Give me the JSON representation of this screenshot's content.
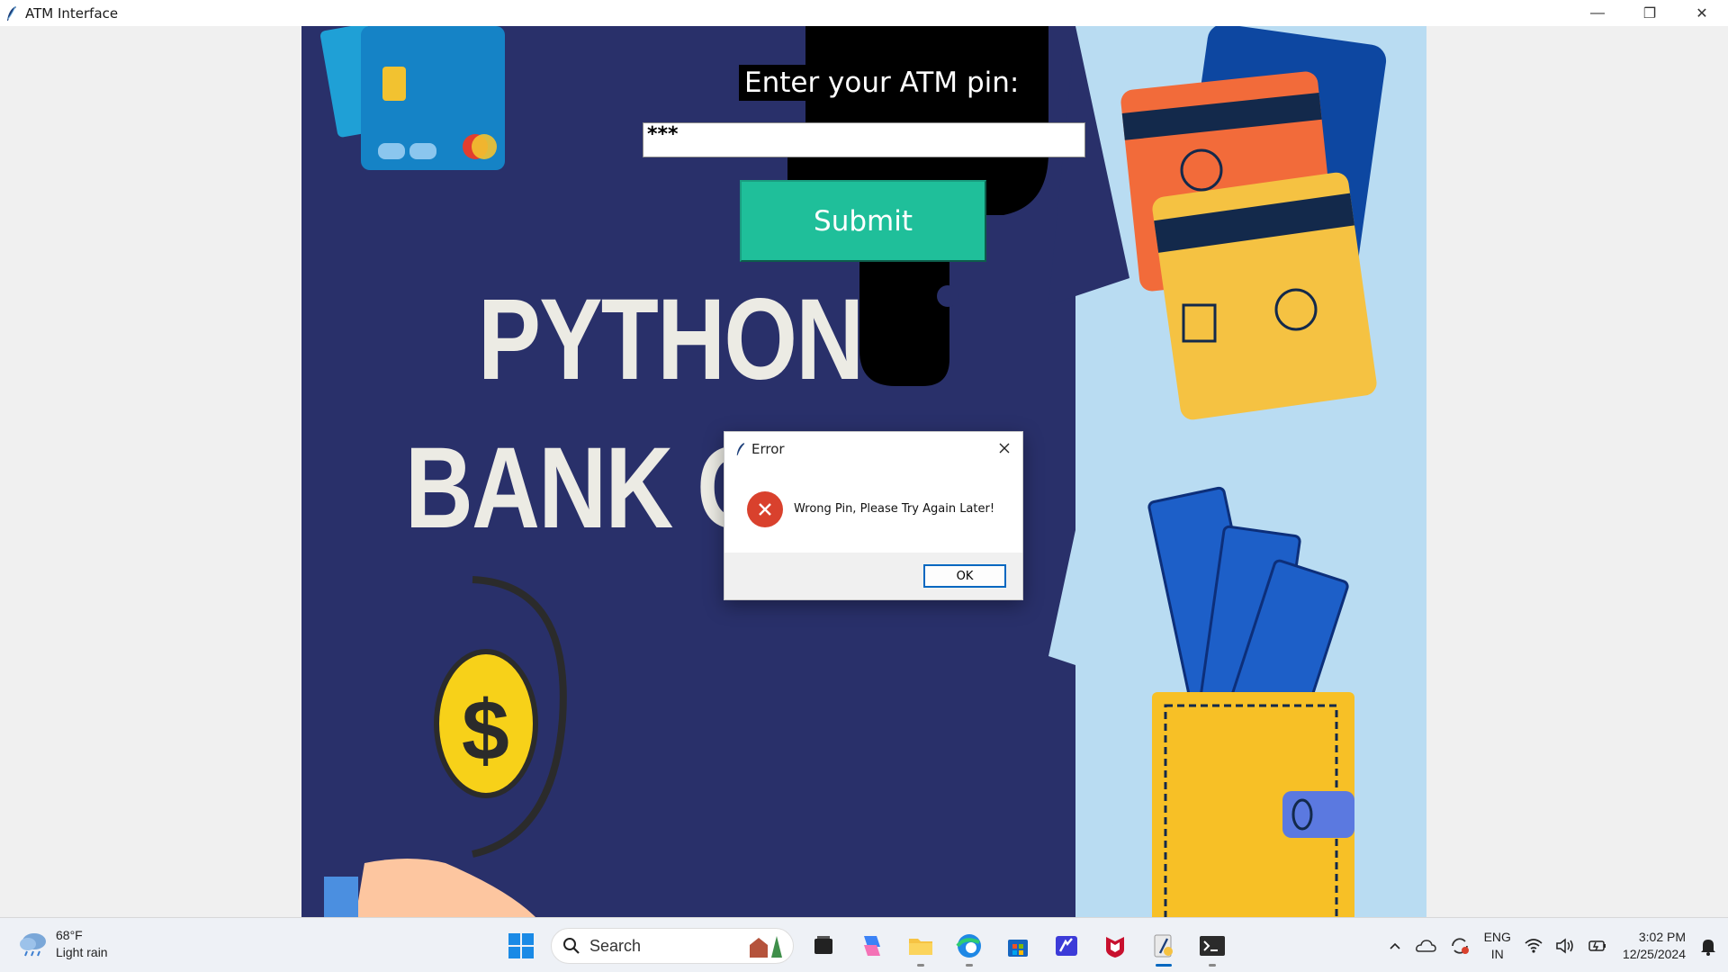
{
  "window": {
    "title": "ATM Interface",
    "minimize": "—",
    "maximize": "❐",
    "close": "✕"
  },
  "app": {
    "pin_label": "Enter your ATM pin:",
    "pin_value": "***",
    "submit_label": "Submit",
    "banner_line1": "PYTHON",
    "banner_line2": "BANK OF"
  },
  "dialog": {
    "title": "Error",
    "message": "Wrong Pin, Please Try Again Later!",
    "ok_label": "OK"
  },
  "taskbar": {
    "weather_temp": "68°F",
    "weather_desc": "Light rain",
    "search_label": "Search",
    "lang_line1": "ENG",
    "lang_line2": "IN",
    "time": "3:02 PM",
    "date": "12/25/2024"
  },
  "colors": {
    "canvas_bg": "#29306a",
    "panel_bg": "#b9dcf2",
    "submit_bg": "#1fbf9a",
    "error_red": "#d9412d",
    "accent": "#0067c0"
  }
}
